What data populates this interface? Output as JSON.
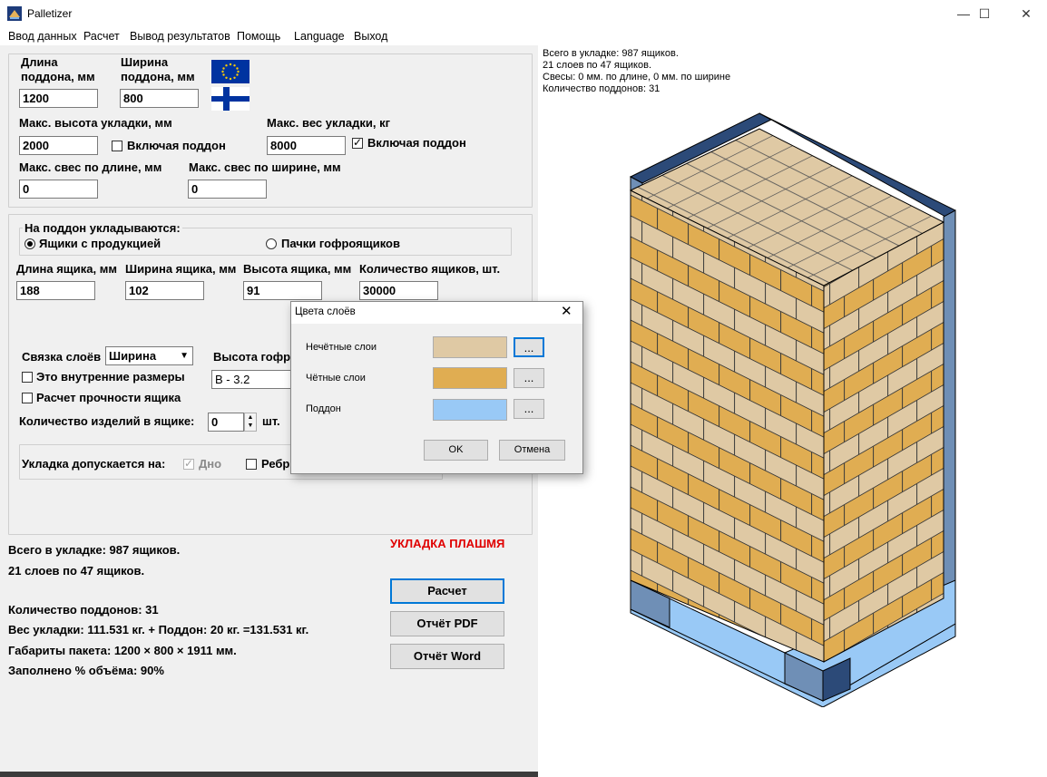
{
  "window": {
    "title": "Palletizer",
    "minimize": "—",
    "maximize": "☐",
    "close": "✕"
  },
  "menu": [
    "Ввод данных",
    "Расчет",
    "Вывод результатов",
    "Помощь",
    "Language",
    "Выход"
  ],
  "pallet": {
    "length_label": "Длина\nподдона, мм",
    "width_label": "Ширина\nподдона, мм",
    "length_value": "1200",
    "width_value": "800",
    "max_height_label": "Макс. высота укладки, мм",
    "max_height_value": "2000",
    "incl_pallet_height_label": "Включая поддон",
    "max_weight_label": "Макс. вес укладки, кг",
    "max_weight_value": "8000",
    "incl_pallet_weight_label": "Включая поддон",
    "overhang_length_label": "Макс. свес по длине, мм",
    "overhang_length_value": "0",
    "overhang_width_label": "Макс. свес по ширине, мм",
    "overhang_width_value": "0"
  },
  "load": {
    "group_label": "На поддон укладываются:",
    "radio_boxes": "Ящики с продукцией",
    "radio_packs": "Пачки гофроящиков",
    "box_length_label": "Длина ящика, мм",
    "box_width_label": "Ширина ящика, мм",
    "box_height_label": "Высота ящика, мм",
    "box_count_label": "Количество ящиков, шт.",
    "box_length_value": "188",
    "box_width_value": "102",
    "box_height_value": "91",
    "box_count_value": "30000",
    "layer_tie_label": "Связка слоёв",
    "layer_tie_value": "Ширина",
    "flute_label": "Высота гофр",
    "flute_value": "B - 3.2",
    "inner_dims_label": "Это внутренние размеры",
    "strength_label": "Расчет прочности ящика",
    "items_label": "Количество изделий в ящике:",
    "items_value": "0",
    "items_unit": "шт.",
    "placement_label": "Укладка допускается на:",
    "bottom_label": "Дно",
    "edge_label": "Ребр"
  },
  "results": {
    "flat_notice": "УКЛАДКА ПЛАШМЯ",
    "total": "Всего в укладке: 987 ящиков.",
    "layers": "21 слоев по 47 ящиков.",
    "pallets": "Количество поддонов: 31",
    "weight": "Вес укладки: 111.531 кг. + Поддон: 20 кг. =131.531 кг.",
    "dims": "Габариты пакета: 1200 × 800 × 1911 мм.",
    "fill": "Заполнено % объёма:  90%"
  },
  "buttons": {
    "calc": "Расчет",
    "pdf": "Отчёт PDF",
    "word": "Отчёт Word"
  },
  "right_info": [
    "Всего в укладке: 987 ящиков.",
    "21 слоев по 47 ящиков.",
    "Свесы: 0 мм. по длине, 0 мм. по ширине",
    "Количество поддонов: 31"
  ],
  "dialog": {
    "title": "Цвета слоёв",
    "odd_label": "Нечётные слои",
    "even_label": "Чётные слои",
    "pallet_label": "Поддон",
    "pick": "...",
    "ok": "OK",
    "cancel": "Отмена"
  },
  "colors": {
    "odd": "#dfc9a4",
    "even": "#e0ad52",
    "pallet": "#99c9f6",
    "notice": "#e00000",
    "accent": "#0078d7"
  }
}
